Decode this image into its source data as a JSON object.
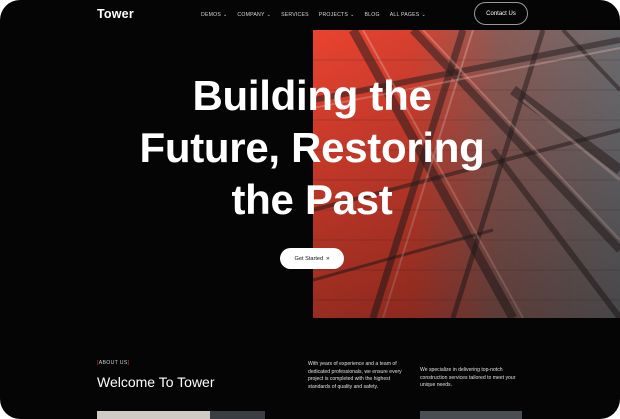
{
  "brand": {
    "name": "Tower"
  },
  "nav": {
    "items": [
      {
        "label": "DEMOS",
        "has_dropdown": true
      },
      {
        "label": "COMPANY",
        "has_dropdown": true
      },
      {
        "label": "SERVICES",
        "has_dropdown": false
      },
      {
        "label": "PROJECTS",
        "has_dropdown": true
      },
      {
        "label": "BLOG",
        "has_dropdown": false
      },
      {
        "label": "ALL PAGES",
        "has_dropdown": true
      }
    ],
    "contact_label": "Contact Us"
  },
  "hero": {
    "title_lines": [
      "Building the",
      "Future, Restoring",
      "the Past"
    ],
    "cta_label": "Get Started",
    "cta_icon": "double-chevron-right-icon",
    "image_tint": "#e8412c"
  },
  "about": {
    "tag_open": "[",
    "tag_text": "ABOUT US",
    "tag_close": "]",
    "heading": "Welcome To Tower",
    "paragraph_1": "With years of experience and a team of dedicated professionals, we ensure every project is completed with the highest standards of quality and safety.",
    "paragraph_2": "We specialize in delivering top-notch construction services tailored to meet your unique needs."
  },
  "colors": {
    "background": "#050505",
    "accent": "#e53a2a",
    "text": "#ffffff"
  }
}
